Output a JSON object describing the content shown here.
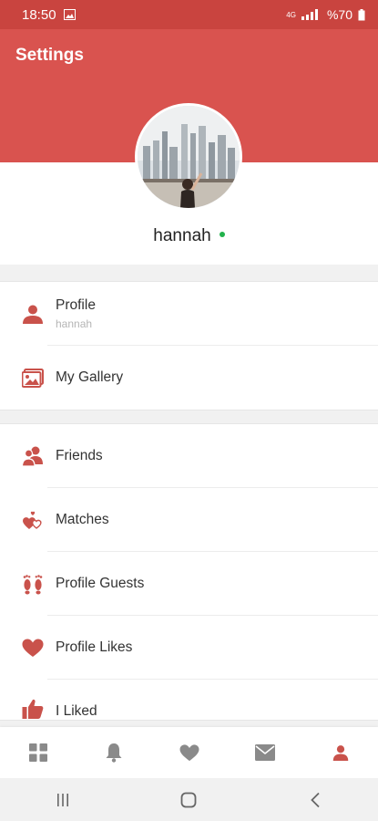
{
  "status_bar": {
    "time": "18:50",
    "battery": "%70",
    "network": "4G"
  },
  "app_bar": {
    "title": "Settings"
  },
  "profile": {
    "name": "hannah",
    "online": true
  },
  "colors": {
    "brand": "#d9534f",
    "brand_dark": "#c9443f",
    "icon": "#c9524b",
    "online": "#22b24c",
    "nav_inactive": "#8a8a8a"
  },
  "menu_group_1": [
    {
      "label": "Profile",
      "sub": "hannah",
      "icon": "person-icon"
    },
    {
      "label": "My Gallery",
      "icon": "gallery-icon"
    }
  ],
  "menu_group_2": [
    {
      "label": "Friends",
      "icon": "friends-icon"
    },
    {
      "label": "Matches",
      "icon": "matches-icon"
    },
    {
      "label": "Profile Guests",
      "icon": "footprints-icon"
    },
    {
      "label": "Profile Likes",
      "icon": "heart-icon"
    },
    {
      "label": "I Liked",
      "icon": "thumbs-up-icon"
    }
  ],
  "bottom_nav": [
    "dashboard-icon",
    "bell-icon",
    "heart-icon",
    "mail-icon",
    "person-icon"
  ],
  "system_nav": [
    "recents-icon",
    "home-icon",
    "back-icon"
  ]
}
